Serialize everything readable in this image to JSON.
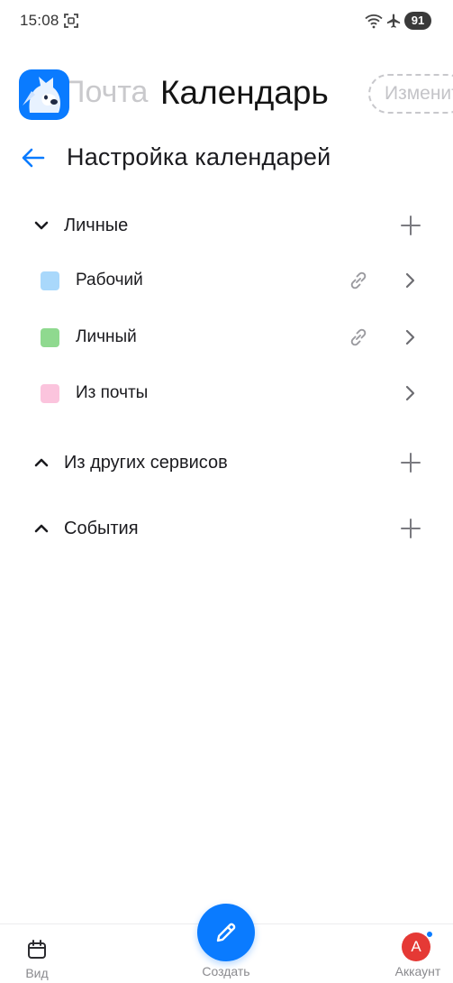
{
  "status_bar": {
    "time": "15:08",
    "battery": "91"
  },
  "app_header": {
    "mail_tab": "Почта",
    "title": "Календарь",
    "edit_button": "Изменить"
  },
  "page": {
    "title": "Настройка календарей"
  },
  "sections": {
    "personal": {
      "label": "Личные",
      "expanded": true,
      "calendars": [
        {
          "label": "Рабочий",
          "color": "#a9d8fb",
          "has_link": true
        },
        {
          "label": "Личный",
          "color": "#8fd98f",
          "has_link": true
        },
        {
          "label": "Из почты",
          "color": "#fbc4dd",
          "has_link": false
        }
      ]
    },
    "other_services": {
      "label": "Из других сервисов",
      "expanded": false
    },
    "events": {
      "label": "События",
      "expanded": false
    }
  },
  "bottom_nav": {
    "view_label": "Вид",
    "create_label": "Создать",
    "account_label": "Аккаунт",
    "avatar_letter": "А"
  },
  "colors": {
    "accent": "#0a7bff",
    "avatar": "#e53935"
  }
}
